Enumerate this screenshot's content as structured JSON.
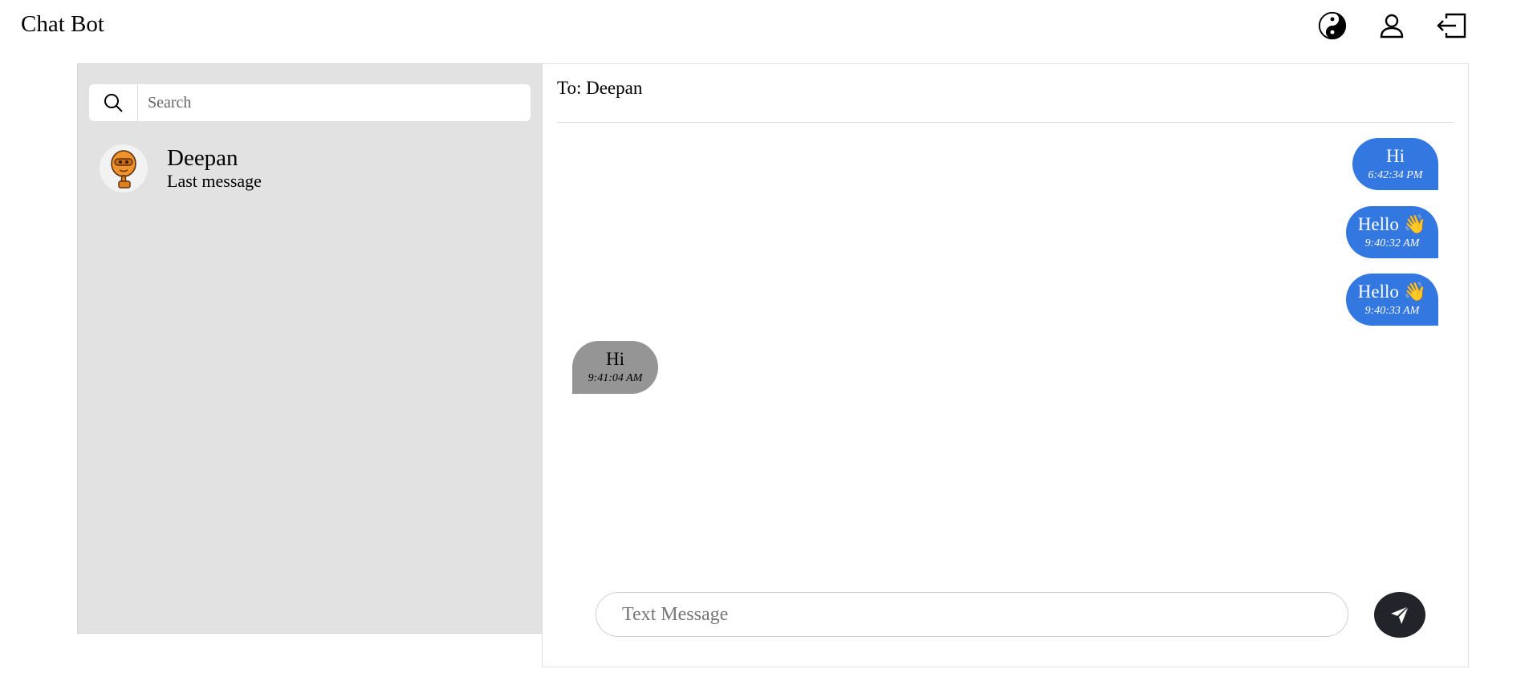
{
  "app": {
    "title": "Chat Bot"
  },
  "header": {
    "icons": [
      "theme-toggle-icon",
      "user-icon",
      "logout-icon"
    ]
  },
  "sidebar": {
    "search": {
      "placeholder": "Search"
    },
    "contacts": [
      {
        "name": "Deepan",
        "last_message": "Last message",
        "avatar_icon": "robot-avatar"
      }
    ]
  },
  "chat": {
    "to_label": "To: Deepan",
    "messages": [
      {
        "direction": "out",
        "text": "Hi",
        "time": "6:42:34 PM"
      },
      {
        "direction": "out",
        "text": "Hello 👋",
        "time": "9:40:32 AM"
      },
      {
        "direction": "out",
        "text": "Hello 👋",
        "time": "9:40:33 AM"
      },
      {
        "direction": "in",
        "text": "Hi",
        "time": "9:41:04 AM"
      }
    ],
    "composer": {
      "placeholder": "Text Message"
    }
  },
  "colors": {
    "outgoing_bubble": "#3377e0",
    "incoming_bubble": "#959595",
    "sidebar_bg": "#e2e2e2",
    "send_button": "#212529"
  }
}
